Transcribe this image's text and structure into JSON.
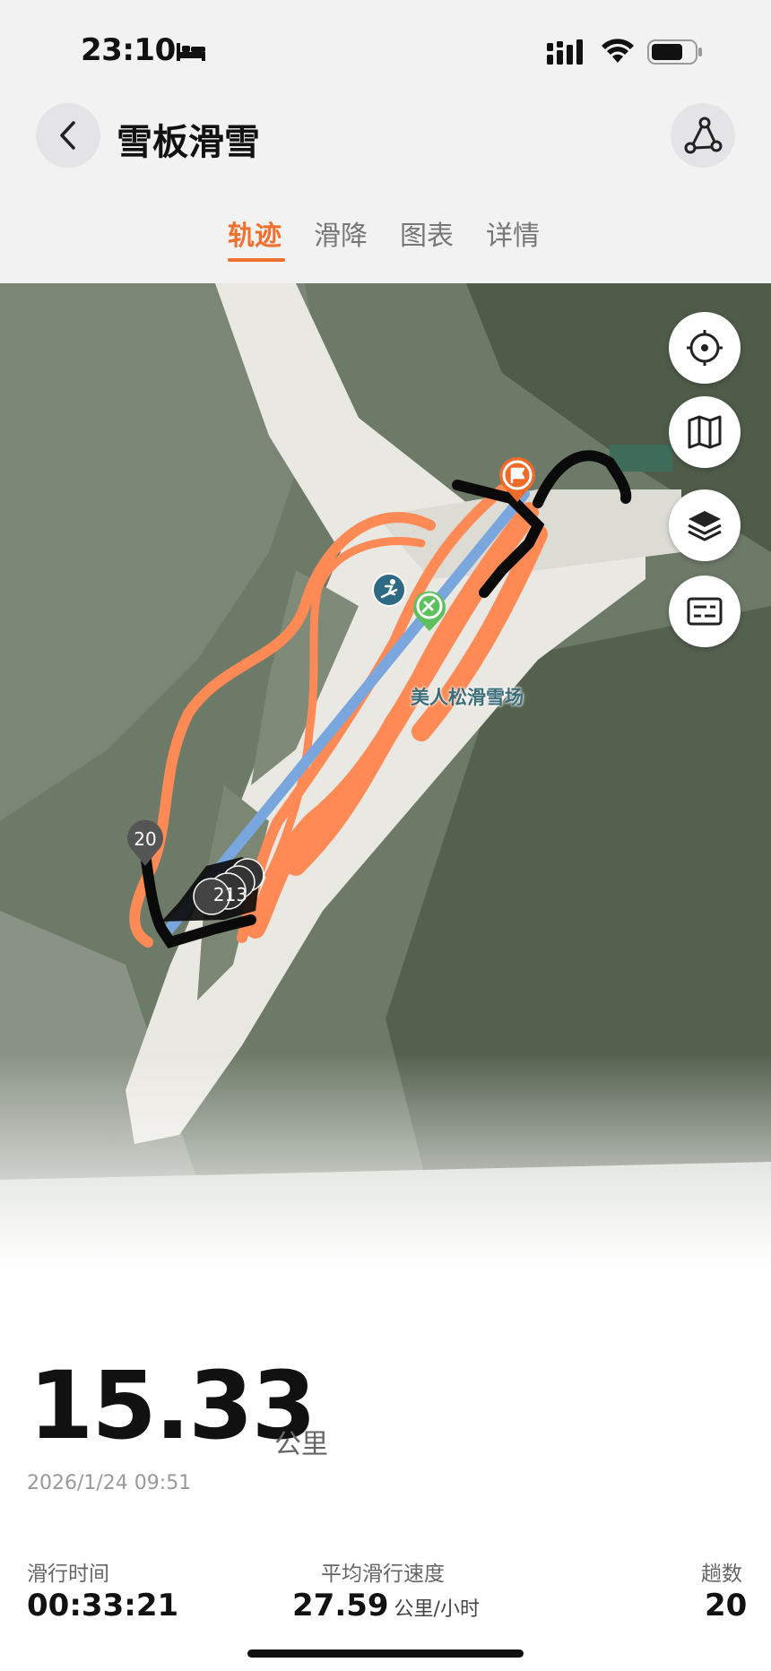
{
  "status_bar": {
    "time": "23:10",
    "icons": [
      "bed-icon",
      "signal-icon",
      "wifi-icon",
      "battery-icon"
    ]
  },
  "header": {
    "title": "雪板滑雪",
    "back_icon": "chevron-left-icon",
    "route_icon": "route-icon"
  },
  "tabs": [
    {
      "label": "轨迹",
      "active": true
    },
    {
      "label": "滑降",
      "active": false
    },
    {
      "label": "图表",
      "active": false
    },
    {
      "label": "详情",
      "active": false
    }
  ],
  "map": {
    "poi_label": "美人松滑雪场",
    "lap_marker_start": "20",
    "lap_marker_cluster": "213",
    "controls": [
      "locate-icon",
      "map-view-icon",
      "layers-icon",
      "legend-icon"
    ],
    "colors": {
      "descent": "#ff8a55",
      "lift": "#7aa6de",
      "idle": "#0a0a0a",
      "start": "#f06a2a",
      "poi": "#5cc05c"
    }
  },
  "summary": {
    "distance": "15.33",
    "distance_unit": "公里",
    "date": "2026/1/24 09:51",
    "stats": {
      "time_label": "滑行时间",
      "time_value": "00:33:21",
      "speed_label": "平均滑行速度",
      "speed_value": "27.59",
      "speed_unit": "公里/小时",
      "runs_label": "趟数",
      "runs_value": "20"
    }
  }
}
